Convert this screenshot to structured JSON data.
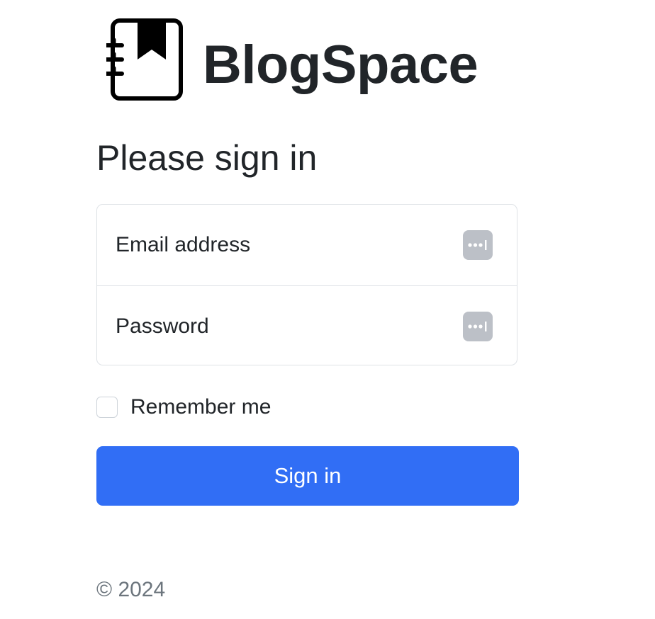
{
  "brand": {
    "name": "BlogSpace",
    "icon": "journal-bookmark-icon"
  },
  "form": {
    "heading": "Please sign in",
    "email_label": "Email address",
    "password_label": "Password",
    "autofill_icon": "password-manager-icon",
    "remember_label": "Remember me",
    "remember_checked": false,
    "submit_label": "Sign in"
  },
  "footer": {
    "copyright": "© 2024"
  },
  "colors": {
    "primary": "#316ef5",
    "text": "#212529",
    "muted": "#6c757d",
    "border": "#dee2e6",
    "autofill_icon_bg": "#bcc0c7"
  }
}
